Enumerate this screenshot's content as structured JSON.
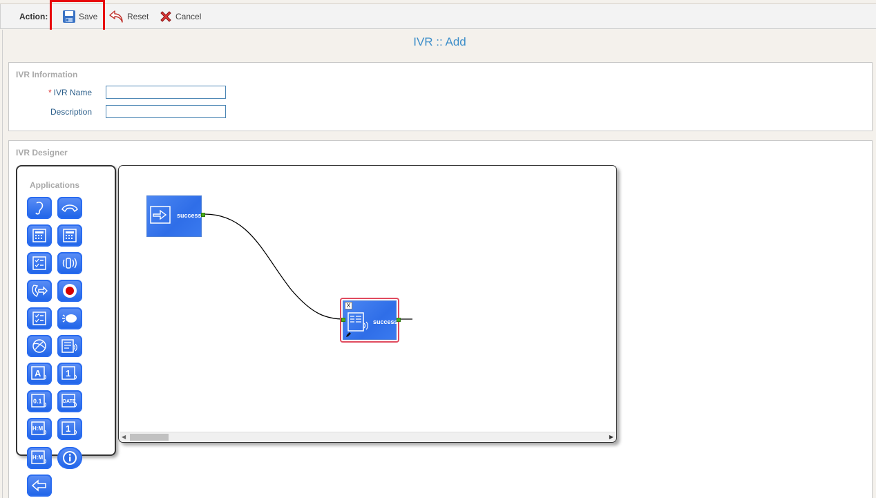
{
  "toolbar": {
    "action_label": "Action:",
    "save_label": "Save",
    "reset_label": "Reset",
    "cancel_label": "Cancel"
  },
  "page": {
    "title": "IVR :: Add"
  },
  "ivr_information": {
    "legend": "IVR Information",
    "required_marker": "*",
    "ivr_name_label": "IVR Name",
    "ivr_name_value": "",
    "description_label": "Description",
    "description_value": ""
  },
  "designer": {
    "legend": "IVR Designer",
    "palette_title": "Applications",
    "palette_icons": [
      "ear-icon",
      "hangup-icon",
      "calculator-icon",
      "calculator-icon",
      "checklist-icon",
      "speaker-icon",
      "call-forward-icon",
      "record-icon",
      "checklist-icon",
      "voice-bubble-icon",
      "globe-icon",
      "prompt-icon",
      "say-alpha-icon",
      "say-number-icon",
      "say-digits-icon",
      "say-date-icon",
      "say-time-icon",
      "say-number-icon",
      "say-time-icon",
      "info-icon",
      "back-arrow-icon"
    ],
    "nodes": [
      {
        "name": "start-node",
        "port_label": "success"
      },
      {
        "name": "prompt-node",
        "port_label": "success",
        "close_label": "X"
      }
    ]
  },
  "colors": {
    "accent": "#3d8ec9",
    "node_blue": "#2f6ee8",
    "highlight_red": "#e8080b",
    "port_green": "#4caf1c"
  }
}
